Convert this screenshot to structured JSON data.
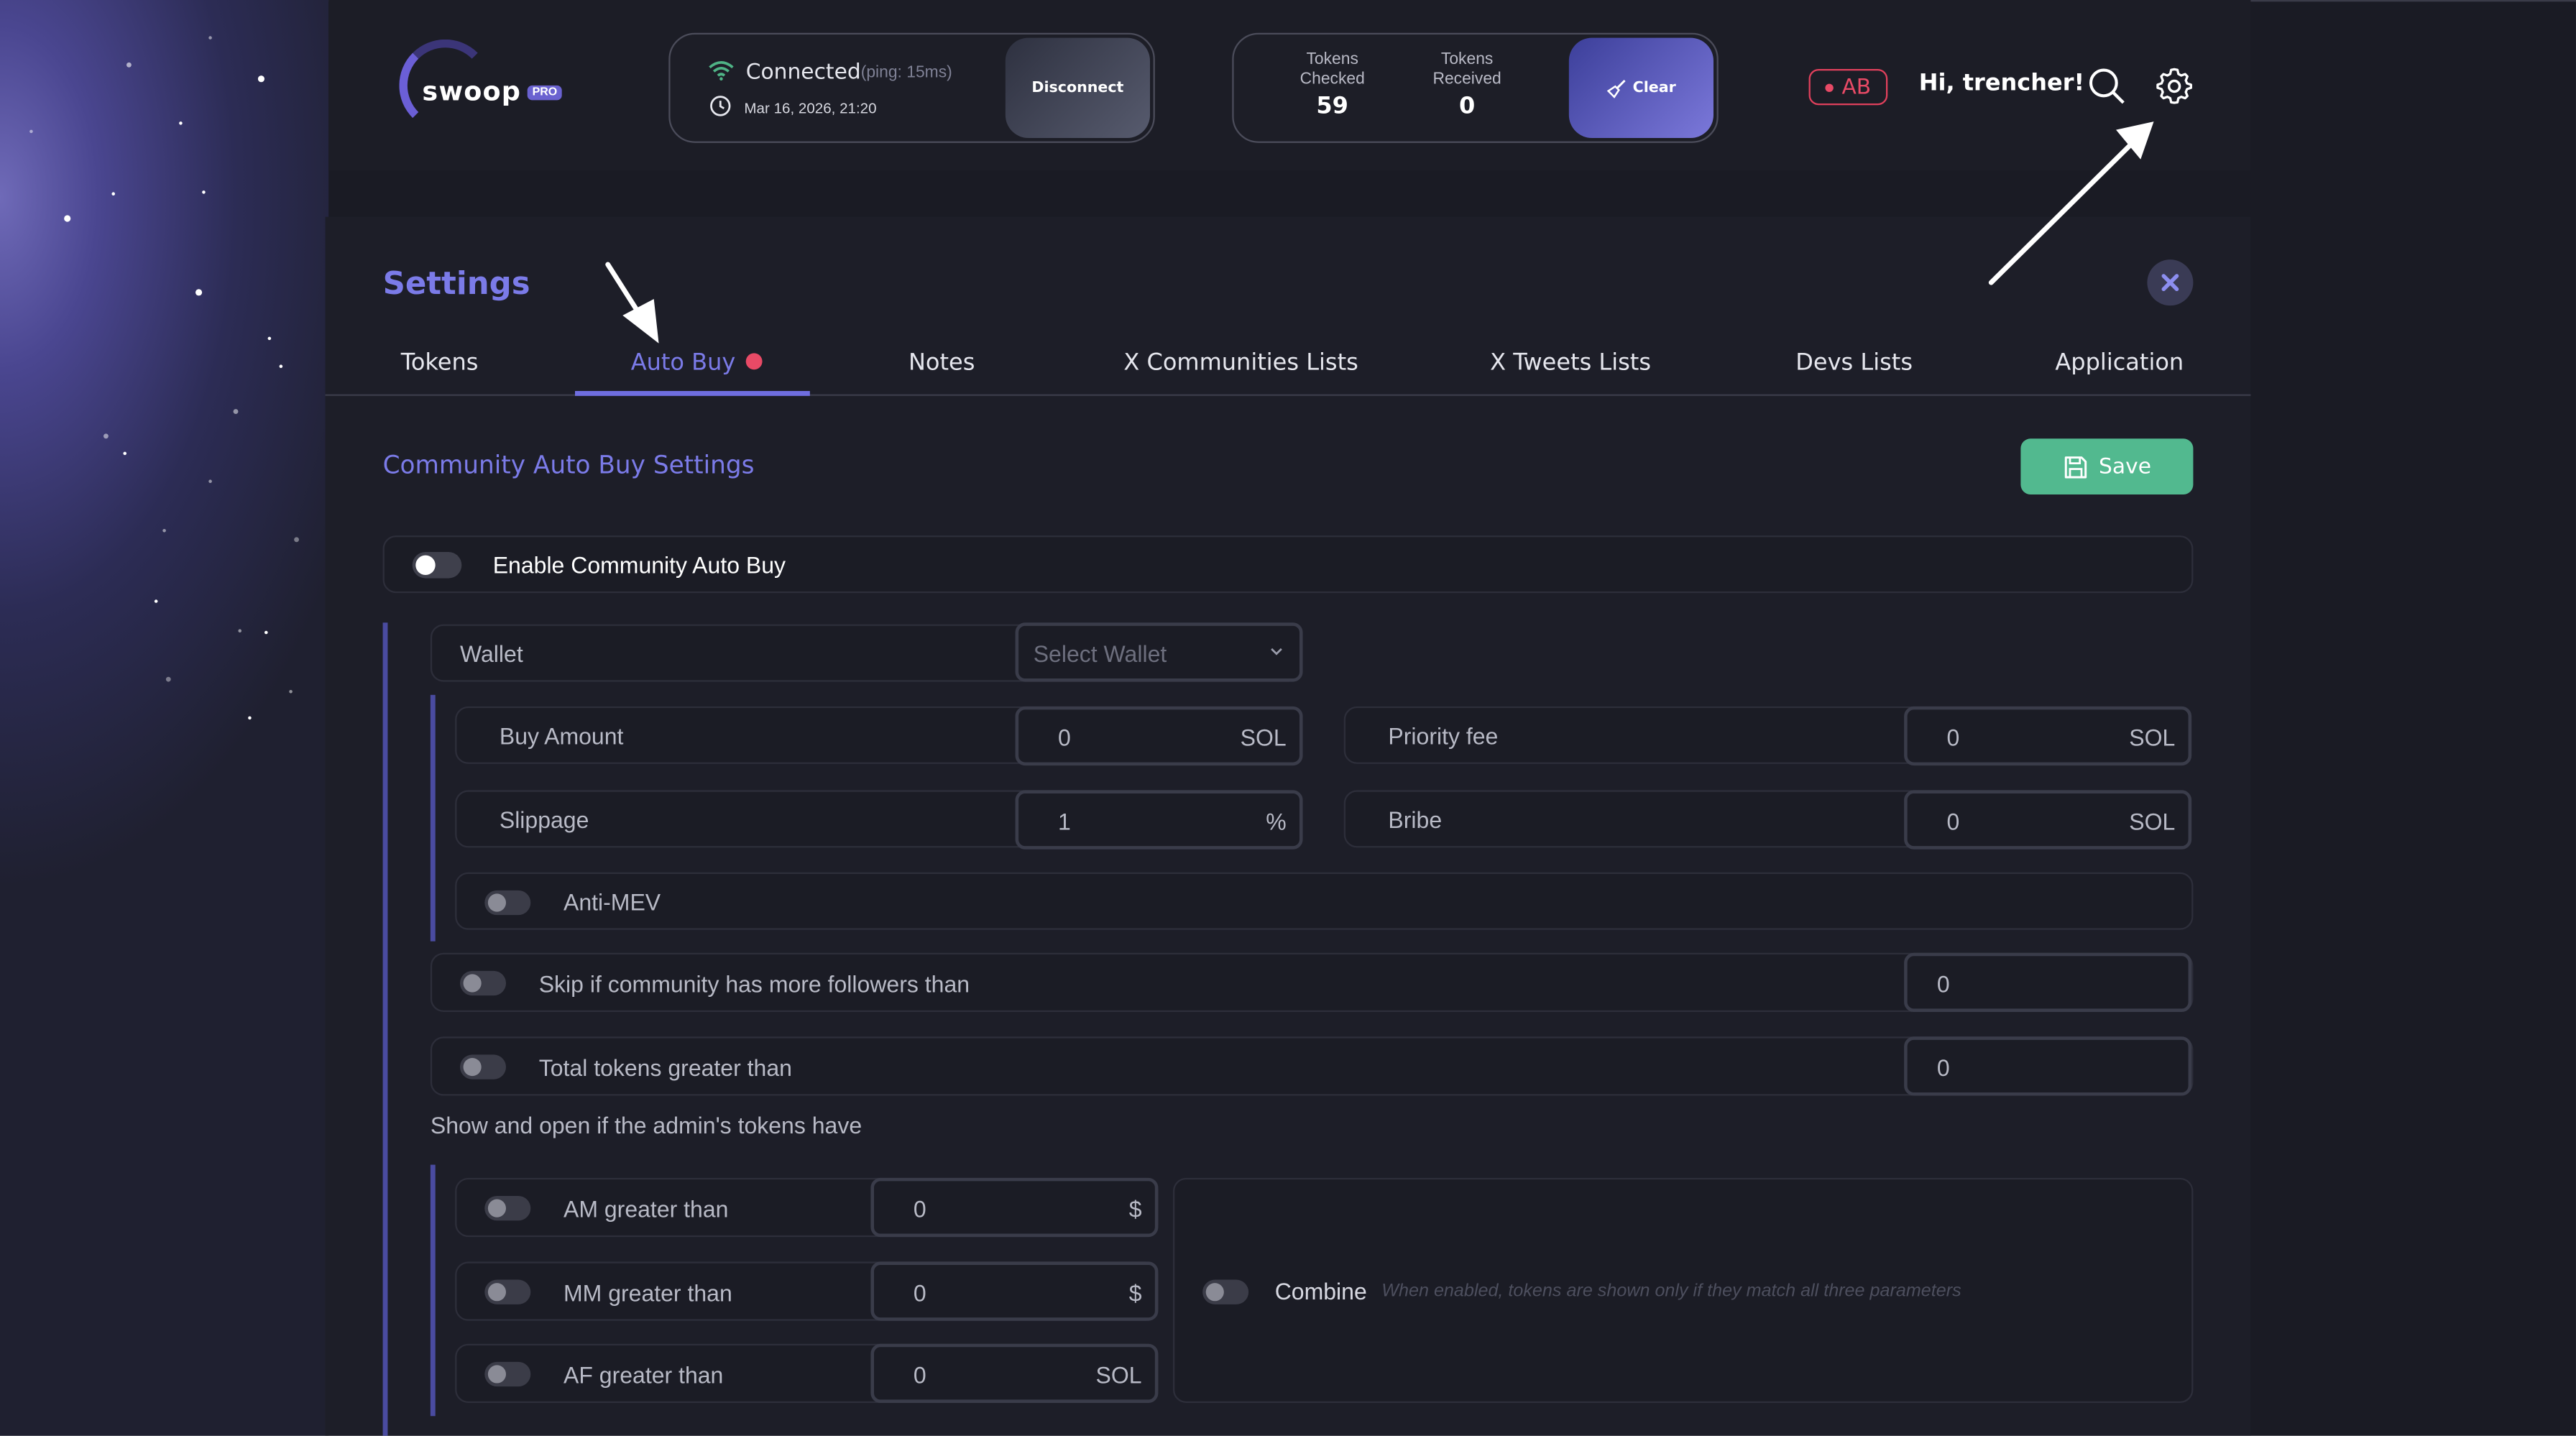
{
  "app": {
    "logo_text": "swoop",
    "logo_badge": "PRO"
  },
  "connection": {
    "status": "Connected",
    "ping": "(ping: 15ms)",
    "datetime": "Mar 16, 2026, 21:20",
    "disconnect_label": "Disconnect"
  },
  "tokens": {
    "checked_label": "Tokens Checked",
    "checked_value": "59",
    "received_label": "Tokens Received",
    "received_value": "0",
    "clear_label": "Clear"
  },
  "user": {
    "badge": "AB",
    "greeting": "Hi, trencher!"
  },
  "settings": {
    "title": "Settings",
    "tabs": [
      {
        "label": "Tokens"
      },
      {
        "label": "Auto Buy"
      },
      {
        "label": "Notes"
      },
      {
        "label": "X Communities Lists"
      },
      {
        "label": "X Tweets Lists"
      },
      {
        "label": "Devs Lists"
      },
      {
        "label": "Application"
      }
    ],
    "active_tab": "Auto Buy"
  },
  "autobuy": {
    "section_title": "Community Auto Buy Settings",
    "save_label": "Save",
    "enable_label": "Enable Community Auto Buy",
    "wallet_label": "Wallet",
    "wallet_placeholder": "Select Wallet",
    "buy_amount_label": "Buy Amount",
    "buy_amount_value": "0",
    "buy_amount_unit": "SOL",
    "priority_fee_label": "Priority fee",
    "priority_fee_value": "0",
    "priority_fee_unit": "SOL",
    "slippage_label": "Slippage",
    "slippage_value": "1",
    "slippage_unit": "%",
    "bribe_label": "Bribe",
    "bribe_value": "0",
    "bribe_unit": "SOL",
    "antimev_label": "Anti-MEV",
    "skip_followers_label": "Skip if community has more followers than",
    "skip_followers_value": "0",
    "total_tokens_label": "Total tokens greater than",
    "total_tokens_value": "0",
    "admin_section_label": "Show and open if the admin's tokens have",
    "am_label": "AM greater than",
    "am_value": "0",
    "am_unit": "$",
    "mm_label": "MM greater than",
    "mm_value": "0",
    "mm_unit": "$",
    "af_label": "AF greater than",
    "af_value": "0",
    "af_unit": "SOL",
    "combine_label": "Combine",
    "combine_hint": "When enabled, tokens are shown only if they match all three parameters"
  },
  "colors": {
    "accent": "#7b7be8",
    "save": "#52b98f",
    "alert": "#e84a66",
    "background": "#1a1b24"
  }
}
